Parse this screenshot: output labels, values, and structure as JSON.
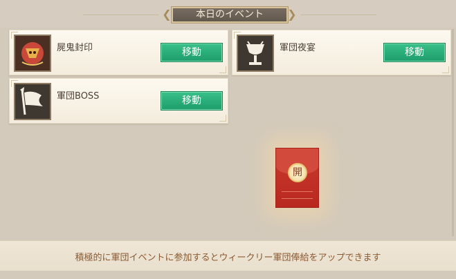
{
  "header": {
    "title": "本日のイベント"
  },
  "events": [
    {
      "name": "屍鬼封印",
      "button": "移動",
      "icon": "seal-icon"
    },
    {
      "name": "軍団夜宴",
      "button": "移動",
      "icon": "goblet-icon"
    },
    {
      "name": "軍団BOSS",
      "button": "移動",
      "icon": "banner-flag-icon"
    }
  ],
  "red_packet": {
    "open_label": "開"
  },
  "footer": {
    "message": "積極的に軍団イベントに参加するとウィークリー軍団俸給をアップできます"
  },
  "colors": {
    "accent_green": "#24a873",
    "red_packet": "#c0312a",
    "footer_text": "#8a5a32"
  }
}
